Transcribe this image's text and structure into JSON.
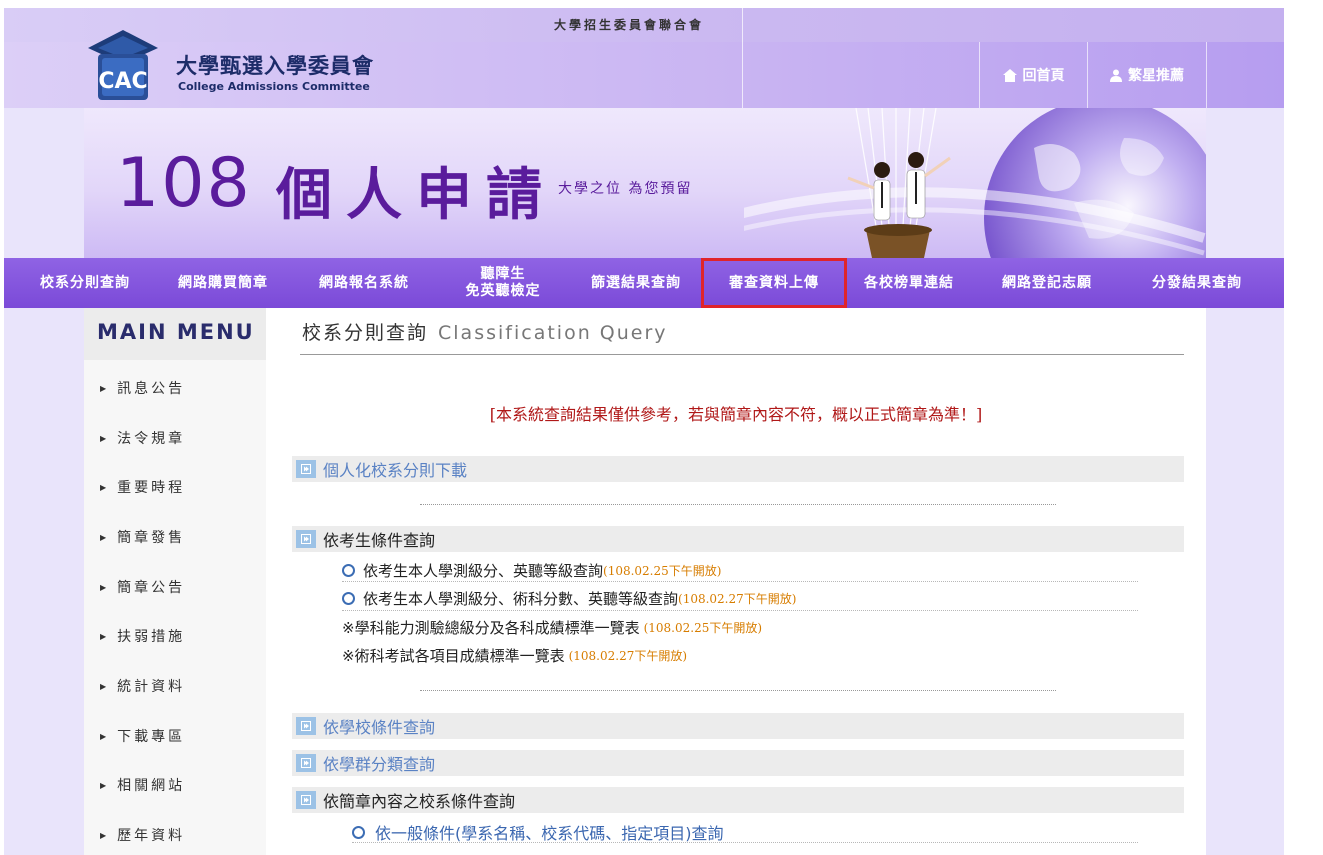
{
  "topbar": {
    "union": "大學招生委員會聯合會"
  },
  "header": {
    "org_zh": "大學甄選入學委員會",
    "org_en": "College Admissions Committee",
    "logo_text": "CAC",
    "home": "回首頁",
    "star": "繁星推薦"
  },
  "banner": {
    "year": "108",
    "title": "個人申請",
    "tagline": "大學之位 為您預留"
  },
  "nav": {
    "items": [
      {
        "label": "校系分則查詢"
      },
      {
        "label": "網路購買簡章"
      },
      {
        "label": "網路報名系統"
      },
      {
        "label": "聽障生",
        "label2": "免英聽檢定"
      },
      {
        "label": "篩選結果查詢"
      },
      {
        "label": "審查資料上傳"
      },
      {
        "label": "各校榜單連結"
      },
      {
        "label": "網路登記志願"
      },
      {
        "label": "分發結果查詢"
      }
    ],
    "highlight_color": "#e0242a"
  },
  "sidebar": {
    "title": "MAIN MENU",
    "items": [
      {
        "label": "訊息公告"
      },
      {
        "label": "法令規章"
      },
      {
        "label": "重要時程"
      },
      {
        "label": "簡章發售"
      },
      {
        "label": "簡章公告"
      },
      {
        "label": "扶弱措施"
      },
      {
        "label": "統計資料"
      },
      {
        "label": "下載專區"
      },
      {
        "label": "相關網站"
      },
      {
        "label": "歷年資料"
      }
    ]
  },
  "main": {
    "title_zh": "校系分則查詢",
    "title_en": "Classification Query",
    "notice": "[本系統查詢結果僅供參考，若與簡章內容不符，概以正式簡章為準！]",
    "sections": [
      {
        "label": "個人化校系分則下載"
      },
      {
        "label": "依考生條件查詢"
      },
      {
        "label": "依學校條件查詢"
      },
      {
        "label": "依學群分類查詢"
      },
      {
        "label": "依簡章內容之校系條件查詢"
      }
    ],
    "cond_rows": [
      {
        "text": "依考生本人學測級分、英聽等級查詢",
        "date": "(108.02.25下午開放)"
      },
      {
        "text": "依考生本人學測級分、術科分數、英聽等級查詢",
        "date": "(108.02.27下午開放)"
      },
      {
        "text": "※學科能力測驗總級分及各科成績標準一覽表",
        "date": "(108.02.25下午開放)"
      },
      {
        "text": "※術科考試各項目成績標準一覽表",
        "date": "(108.02.27下午開放)"
      }
    ],
    "sub_rows": [
      {
        "text": "依一般條件(學系名稱、校系代碼、指定項目)查詢"
      }
    ]
  }
}
